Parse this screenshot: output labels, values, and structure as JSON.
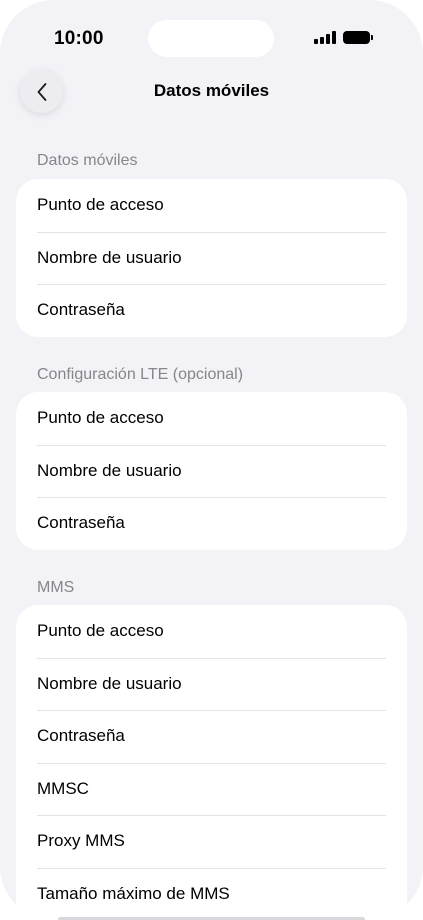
{
  "status_bar": {
    "time": "10:00"
  },
  "nav": {
    "title": "Datos móviles",
    "back_icon": "chevron-left-icon"
  },
  "sections": [
    {
      "header": "Datos móviles",
      "rows": [
        "Punto de acceso",
        "Nombre de usuario",
        "Contraseña"
      ]
    },
    {
      "header": "Configuración LTE (opcional)",
      "rows": [
        "Punto de acceso",
        "Nombre de usuario",
        "Contraseña"
      ]
    },
    {
      "header": "MMS",
      "rows": [
        "Punto de acceso",
        "Nombre de usuario",
        "Contraseña",
        "MMSC",
        "Proxy MMS",
        "Tamaño máximo de MMS"
      ]
    }
  ],
  "colors": {
    "background": "#f2f2f7",
    "card": "#ffffff",
    "section_header": "#86868b",
    "separator": "#e3e3e8"
  }
}
